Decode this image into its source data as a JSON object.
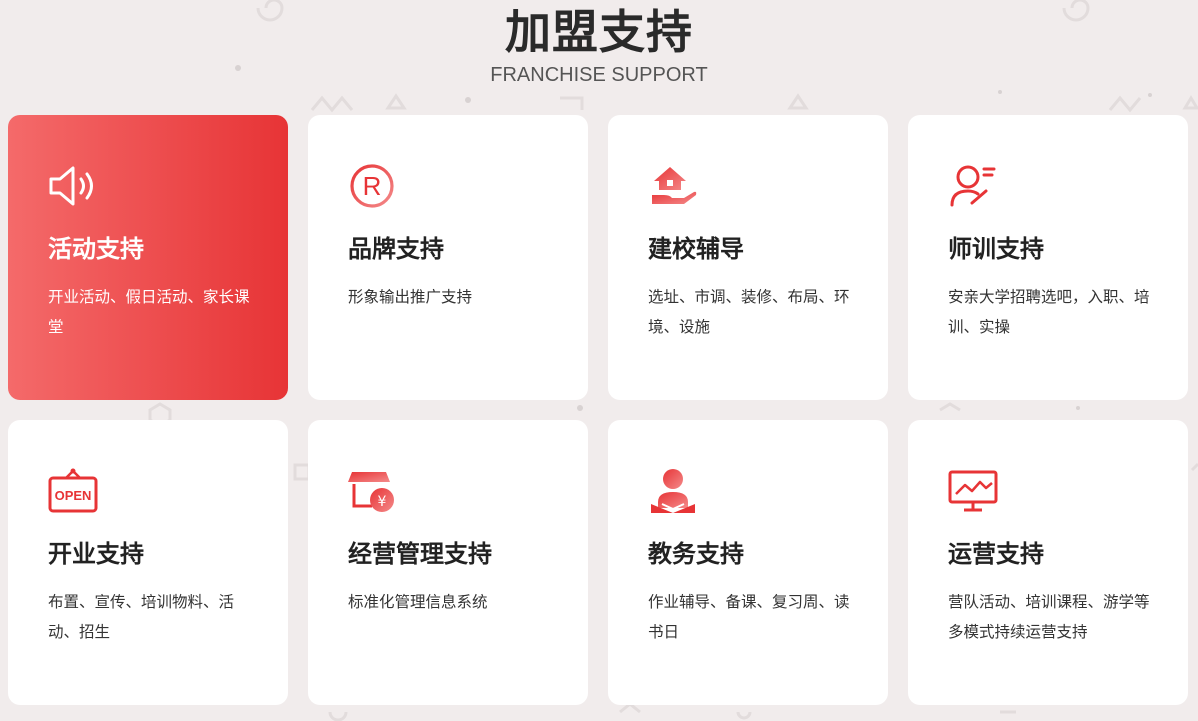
{
  "header": {
    "title": "加盟支持",
    "subtitle": "FRANCHISE SUPPORT"
  },
  "colors": {
    "accent": "#e73436",
    "accent_light": "#f46a6a",
    "background": "#f1ecec",
    "card": "#ffffff"
  },
  "cards": [
    {
      "icon": "speaker-icon",
      "title": "活动支持",
      "desc": "开业活动、假日活动、家长课堂",
      "active": true
    },
    {
      "icon": "registered-trademark-icon",
      "title": "品牌支持",
      "desc": "形象输出推广支持",
      "active": false
    },
    {
      "icon": "house-hand-icon",
      "title": "建校辅导",
      "desc": "选址、市调、装修、布局、环境、设施",
      "active": false
    },
    {
      "icon": "teacher-icon",
      "title": "师训支持",
      "desc": "安亲大学招聘选吧，入职、培训、实操",
      "active": false
    },
    {
      "icon": "open-sign-icon",
      "title": "开业支持",
      "desc": "布置、宣传、培训物料、活动、招生",
      "active": false
    },
    {
      "icon": "shop-yuan-icon",
      "title": "经营管理支持",
      "desc": "标准化管理信息系统",
      "active": false
    },
    {
      "icon": "student-icon",
      "title": "教务支持",
      "desc": "作业辅导、备课、复习周、读书日",
      "active": false
    },
    {
      "icon": "monitor-chart-icon",
      "title": "运营支持",
      "desc": "营队活动、培训课程、游学等多模式持续运营支持",
      "active": false
    }
  ]
}
